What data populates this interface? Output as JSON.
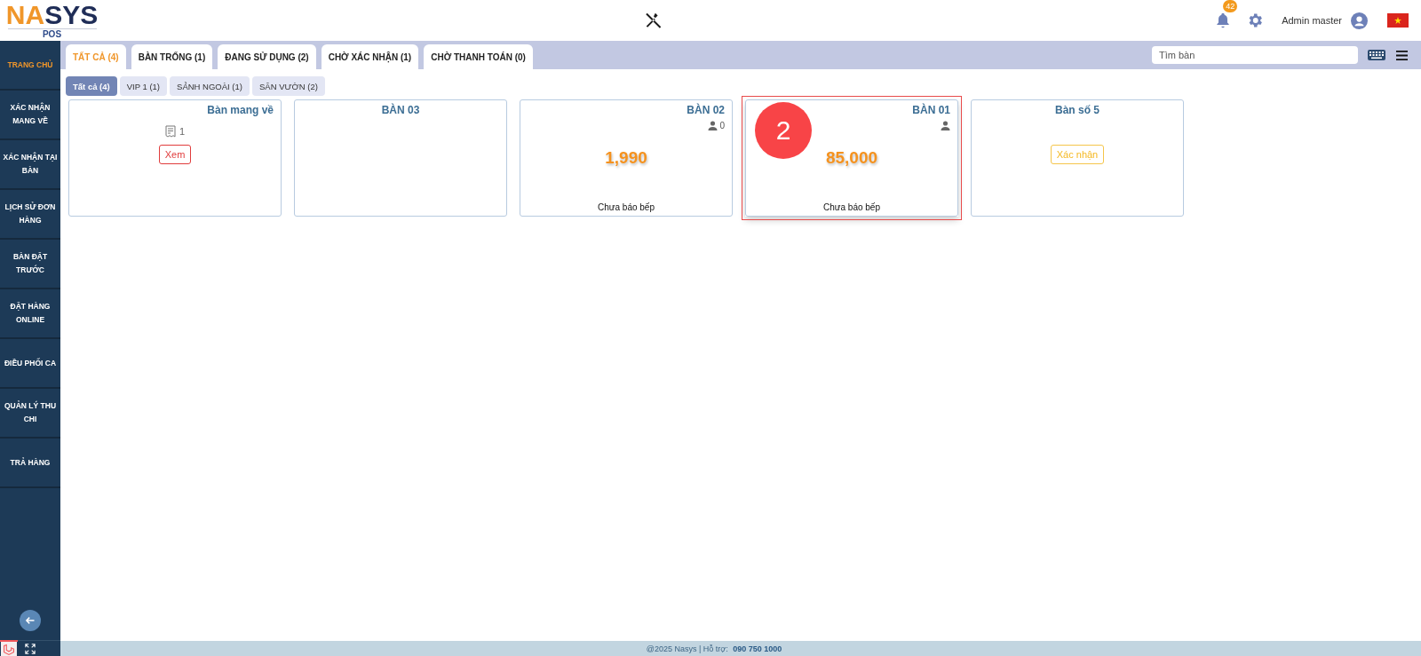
{
  "header": {
    "logo": {
      "parts": [
        {
          "text": "NA",
          "color": "#f0962a"
        },
        {
          "text": "SYS",
          "color": "#1f2d57"
        }
      ],
      "subtitle": "POS"
    },
    "notifications": "42",
    "user": "Admin master"
  },
  "sidebar": {
    "items": [
      {
        "label": "TRANG CHỦ",
        "selected": true
      },
      {
        "label": "XÁC NHẬN MANG VỀ",
        "selected": false
      },
      {
        "label": "XÁC NHẬN TẠI BÀN",
        "selected": false
      },
      {
        "label": "LỊCH SỬ ĐƠN HÀNG",
        "selected": false
      },
      {
        "label": "BÀN ĐẶT TRƯỚC",
        "selected": false
      },
      {
        "label": "ĐẶT HÀNG ONLINE",
        "selected": false
      },
      {
        "label": "ĐIỀU PHỐI CA",
        "selected": false
      },
      {
        "label": "QUẢN LÝ THU CHI",
        "selected": false
      },
      {
        "label": "TRẢ HÀNG",
        "selected": false
      }
    ]
  },
  "tabs": [
    {
      "label": "TẤT CẢ (4)",
      "selected": true
    },
    {
      "label": "BÀN TRỐNG (1)",
      "selected": false
    },
    {
      "label": "ĐANG SỬ DỤNG (2)",
      "selected": false
    },
    {
      "label": "CHỜ XÁC NHẬN (1)",
      "selected": false
    },
    {
      "label": "CHỜ THANH TOÁN (0)",
      "selected": false
    }
  ],
  "search": {
    "placeholder": "Tìm bàn"
  },
  "areas": [
    {
      "label": "Tất cả (4)",
      "selected": true
    },
    {
      "label": "VIP 1 (1)",
      "selected": false
    },
    {
      "label": "SẢNH NGOÀI (1)",
      "selected": false
    },
    {
      "label": "SÂN VƯỜN (2)",
      "selected": false
    }
  ],
  "tables": [
    {
      "kind": "takeaway",
      "name": "Bàn mang về",
      "order_count": "1",
      "action": "Xem",
      "highlighted": false
    },
    {
      "kind": "empty",
      "name": "BÀN 03",
      "highlighted": false
    },
    {
      "kind": "occupied",
      "name": "BÀN 02",
      "guests": "0",
      "amount": "1,990",
      "status": "Chưa báo bếp",
      "highlighted": false
    },
    {
      "kind": "occupied",
      "name": "BÀN 01",
      "amount": "85,000",
      "status": "Chưa báo bếp",
      "highlighted": true,
      "annotation": "2"
    },
    {
      "kind": "pending",
      "name": "Bàn số 5",
      "action": "Xác nhận",
      "highlighted": false
    }
  ],
  "footer": {
    "text": "@2025 Nasys | Hỗ trợ:",
    "phone": "090 750 1000"
  }
}
